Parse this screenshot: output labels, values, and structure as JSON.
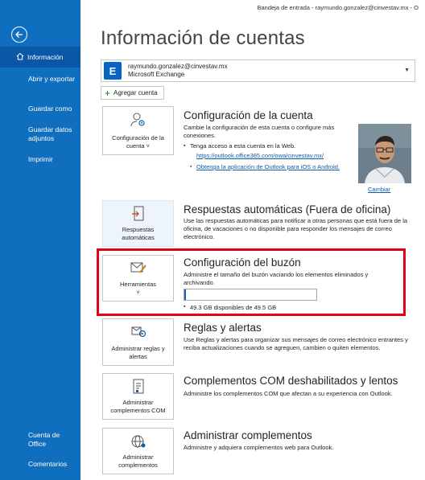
{
  "window": {
    "title": "Bandeja de entrada - raymundo.gonzalez@cinvestav.mx - O"
  },
  "sidebar": {
    "back_icon": "arrow-left-icon",
    "items": [
      {
        "label": "Información",
        "active": true,
        "icon": "home-icon"
      },
      {
        "label": "Abrir y exportar"
      },
      {
        "label": "Guardar como"
      },
      {
        "label": "Guardar datos adjuntos"
      },
      {
        "label": "Imprimir"
      },
      {
        "label": "Cuenta de Office"
      },
      {
        "label": "Comentarios"
      }
    ]
  },
  "page": {
    "title": "Información de cuentas"
  },
  "account": {
    "email": "raymundo.gonzalez@cinvestav.mx",
    "type": "Microsoft Exchange",
    "logo_letter": "E",
    "add_label": "Agregar cuenta"
  },
  "sections": {
    "account_settings": {
      "tile_label": "Configuración de la cuenta",
      "caret": "˅",
      "title": "Configuración de la cuenta",
      "desc": "Cambie la configuración de esta cuenta o configure más conexiones.",
      "bullet1": "Tenga acceso a esta cuenta en la Web.",
      "link1": "https://outlook.office365.com/owa/cinvestav.mx/",
      "link2": "Obtenga la aplicación de Outlook para iOS o Android.",
      "photo_action": "Cambiar"
    },
    "auto_replies": {
      "tile_label": "Respuestas automáticas",
      "title": "Respuestas automáticas (Fuera de oficina)",
      "desc": "Use las respuestas automáticas para notificar a otras personas que está fuera de la oficina, de vacaciones o no disponible para responder los mensajes de correo electrónico."
    },
    "mailbox": {
      "tile_label": "Herramientas",
      "caret": "˅",
      "title": "Configuración del buzón",
      "desc": "Administre el tamaño del buzón vaciando los elementos eliminados y archivando.",
      "free_gb": 49.3,
      "total_gb": 49.5,
      "storage_text": "49.3 GB disponibles de 49.5 GB"
    },
    "rules": {
      "tile_label": "Administrar reglas y alertas",
      "title": "Reglas y alertas",
      "desc": "Use Reglas y alertas para organizar sus mensajes de correo electrónico entrantes y reciba actualizaciones cuando se agreguen, cambien o quiten elementos."
    },
    "com_addins": {
      "tile_label": "Administrar complementos COM",
      "title": "Complementos COM deshabilitados y lentos",
      "desc": "Administre los complementos COM que afectan a su experiencia con Outlook."
    },
    "addins": {
      "tile_label": "Administrar complementos",
      "title": "Administrar complementos",
      "desc": "Administre y adquiera complementos web para Outlook."
    }
  },
  "colors": {
    "sidebar": "#106ebe",
    "accent": "#0f5ca8",
    "highlight": "#e2001a"
  }
}
